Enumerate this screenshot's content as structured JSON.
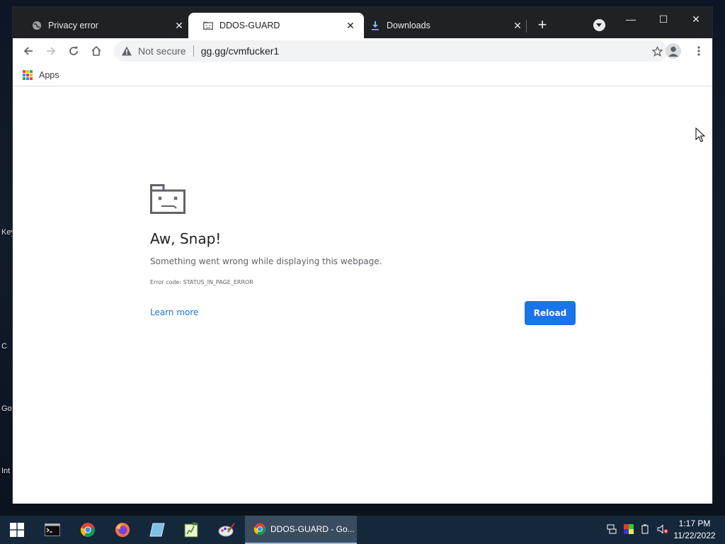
{
  "desktop": {
    "labels": [
      "Key",
      "C",
      "Go",
      "Int"
    ]
  },
  "tabs": [
    {
      "title": "Privacy error",
      "close": "✕",
      "icon": "globe-icon"
    },
    {
      "title": "DDOS-GUARD",
      "close": "✕",
      "icon": "sad-page-icon"
    },
    {
      "title": "Downloads",
      "close": "✕",
      "icon": "download-icon"
    }
  ],
  "tabstrip": {
    "new_tab": "+"
  },
  "window_controls": {
    "minimize": "—",
    "maximize": "☐",
    "close": "✕"
  },
  "omnibox": {
    "security_label": "Not secure",
    "url": "gg.gg/cvmfucker1"
  },
  "bookmarks": {
    "apps_label": "Apps"
  },
  "error_page": {
    "title": "Aw, Snap!",
    "message": "Something went wrong while displaying this webpage.",
    "error_code": "Error code: STATUS_IN_PAGE_ERROR",
    "learn_more": "Learn more",
    "reload": "Reload"
  },
  "taskbar": {
    "active_app": "DDOS-GUARD - Go...",
    "time": "1:17 PM",
    "date": "11/22/2022"
  },
  "colors": {
    "tabstrip": "#202124",
    "accent": "#1a73e8",
    "taskbar": "#15273b"
  }
}
